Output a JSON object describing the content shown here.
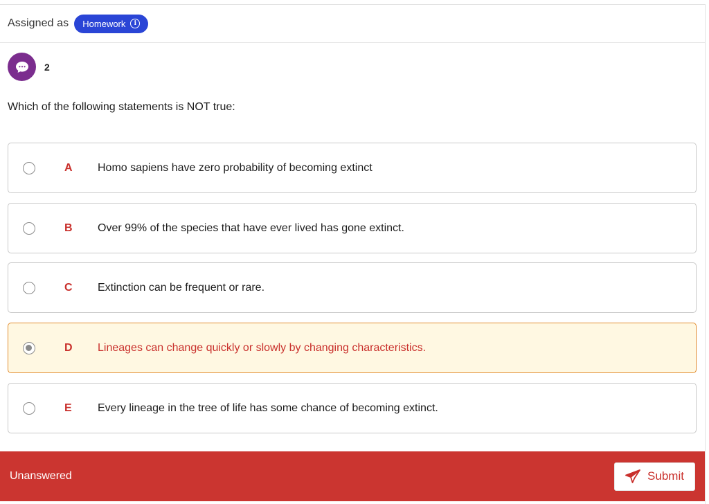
{
  "header": {
    "assigned_label": "Assigned as",
    "badge_label": "Homework"
  },
  "comments": {
    "count": "2",
    "icon": "speech-bubble-icon",
    "color": "#7b2d8e"
  },
  "question": {
    "text": "Which of the following statements is NOT true:"
  },
  "options": [
    {
      "letter": "A",
      "text": "Homo sapiens have zero probability of becoming extinct",
      "selected": false
    },
    {
      "letter": "B",
      "text": "Over 99% of the species that have ever lived has gone extinct.",
      "selected": false
    },
    {
      "letter": "C",
      "text": "Extinction can be frequent or rare.",
      "selected": false
    },
    {
      "letter": "D",
      "text": "Lineages can change quickly or slowly by changing characteristics.",
      "selected": true
    },
    {
      "letter": "E",
      "text": "Every lineage in the tree of life has some chance of becoming extinct.",
      "selected": false
    }
  ],
  "footer": {
    "status": "Unanswered",
    "submit_label": "Submit",
    "submit_icon": "paper-plane-icon"
  },
  "colors": {
    "badge": "#2a45d6",
    "accent_red": "#c9302c",
    "footer_bg": "#cb3530",
    "selected_bg": "#fff8e2",
    "selected_border": "#e28c2f"
  }
}
